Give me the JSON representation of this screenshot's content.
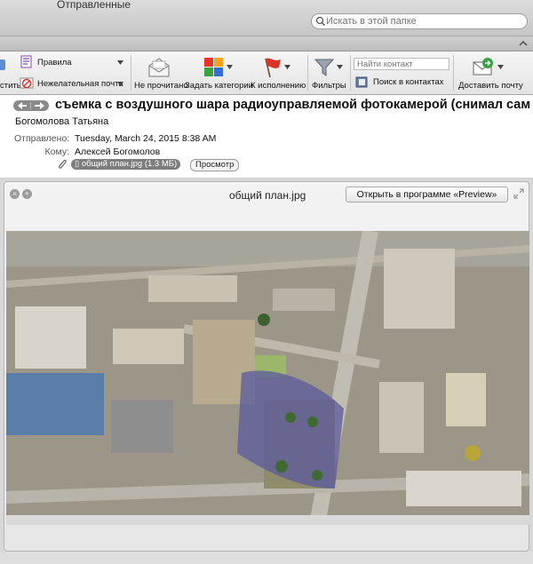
{
  "window": {
    "folder_title": "Отправленные"
  },
  "search": {
    "placeholder": "Искать в этой папке"
  },
  "toolbar": {
    "cut_label": "стить",
    "rules_label": "Правила",
    "junk_label": "Нежелательная почта",
    "unread_label": "Не прочитано",
    "categories_label": "Задать категории",
    "followup_label": "К исполнению",
    "filters_label": "Фильтры",
    "find_contact_placeholder": "Найти контакт",
    "search_contacts_label": "Поиск в контактах",
    "deliver_label": "Доставить почту"
  },
  "message": {
    "subject": "съемка с воздушного шара радиоуправляемой фотокамерой (снимал сам",
    "from": "Богомолова Татьяна",
    "sent_key": "Отправлено:",
    "sent_value": "Tuesday, March 24, 2015 8:38 AM",
    "to_key": "Кому:",
    "to_value": "Алексей Богомолов",
    "attachment": "общий план.jpg (1.3 МБ)",
    "preview_button": "Просмотр"
  },
  "quicklook": {
    "title": "общий план.jpg",
    "open_button": "Открыть в программе «Preview»"
  },
  "icons": {
    "search": "magnifier-icon",
    "rules": "rules-icon",
    "junk": "junk-mail-icon",
    "unread": "envelope-unread-icon",
    "categories": "color-squares-icon",
    "followup": "red-flag-icon",
    "filters": "funnel-icon",
    "contacts": "address-book-icon",
    "deliver": "send-receive-icon"
  },
  "colors": {
    "flag": "#d8342a",
    "accent_green": "#3aa241",
    "pill": "#7d7d7d"
  }
}
